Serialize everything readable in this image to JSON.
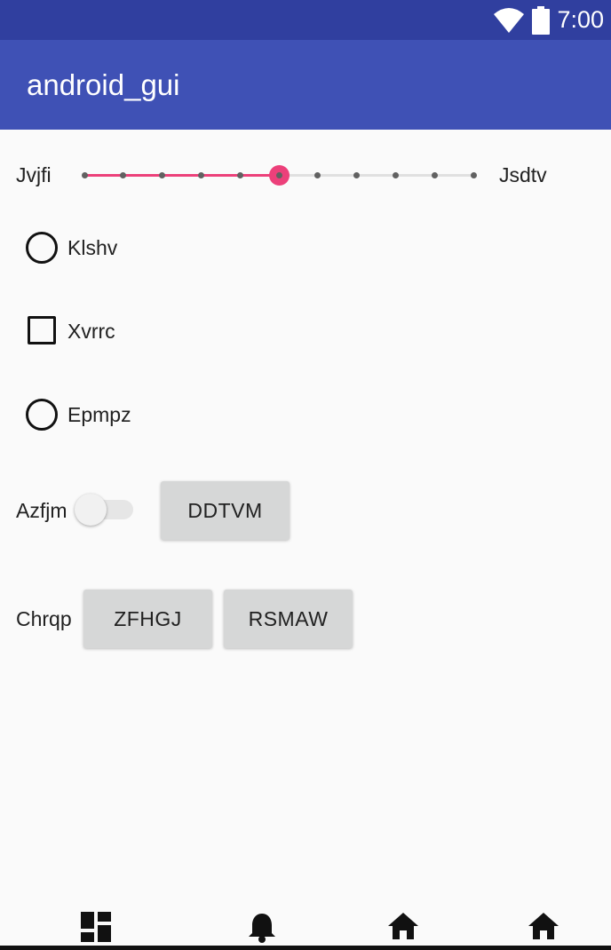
{
  "status_bar": {
    "time": "7:00",
    "icons": [
      "wifi-icon",
      "battery-icon"
    ],
    "color": "#303f9f"
  },
  "app_bar": {
    "title": "android_gui",
    "color": "#3f51b5"
  },
  "slider": {
    "label_left": "Jvjfi",
    "label_right": "Jsdtv",
    "value": 5,
    "max": 10,
    "accent": "#ec407a"
  },
  "options": [
    {
      "type": "radio",
      "label": "Klshv",
      "checked": false
    },
    {
      "type": "checkbox",
      "label": "Xvrrc",
      "checked": false
    },
    {
      "type": "radio",
      "label": "Epmpz",
      "checked": false
    }
  ],
  "switch_row": {
    "label": "Azfjm",
    "on": false,
    "button_label": "DDTVM"
  },
  "button_row": {
    "label": "Chrqp",
    "buttons": [
      "ZFHGJ",
      "RSMAW"
    ]
  },
  "bottom_nav": {
    "icons": [
      "dashboard-icon",
      "bell-icon",
      "home-icon",
      "home-icon"
    ]
  }
}
